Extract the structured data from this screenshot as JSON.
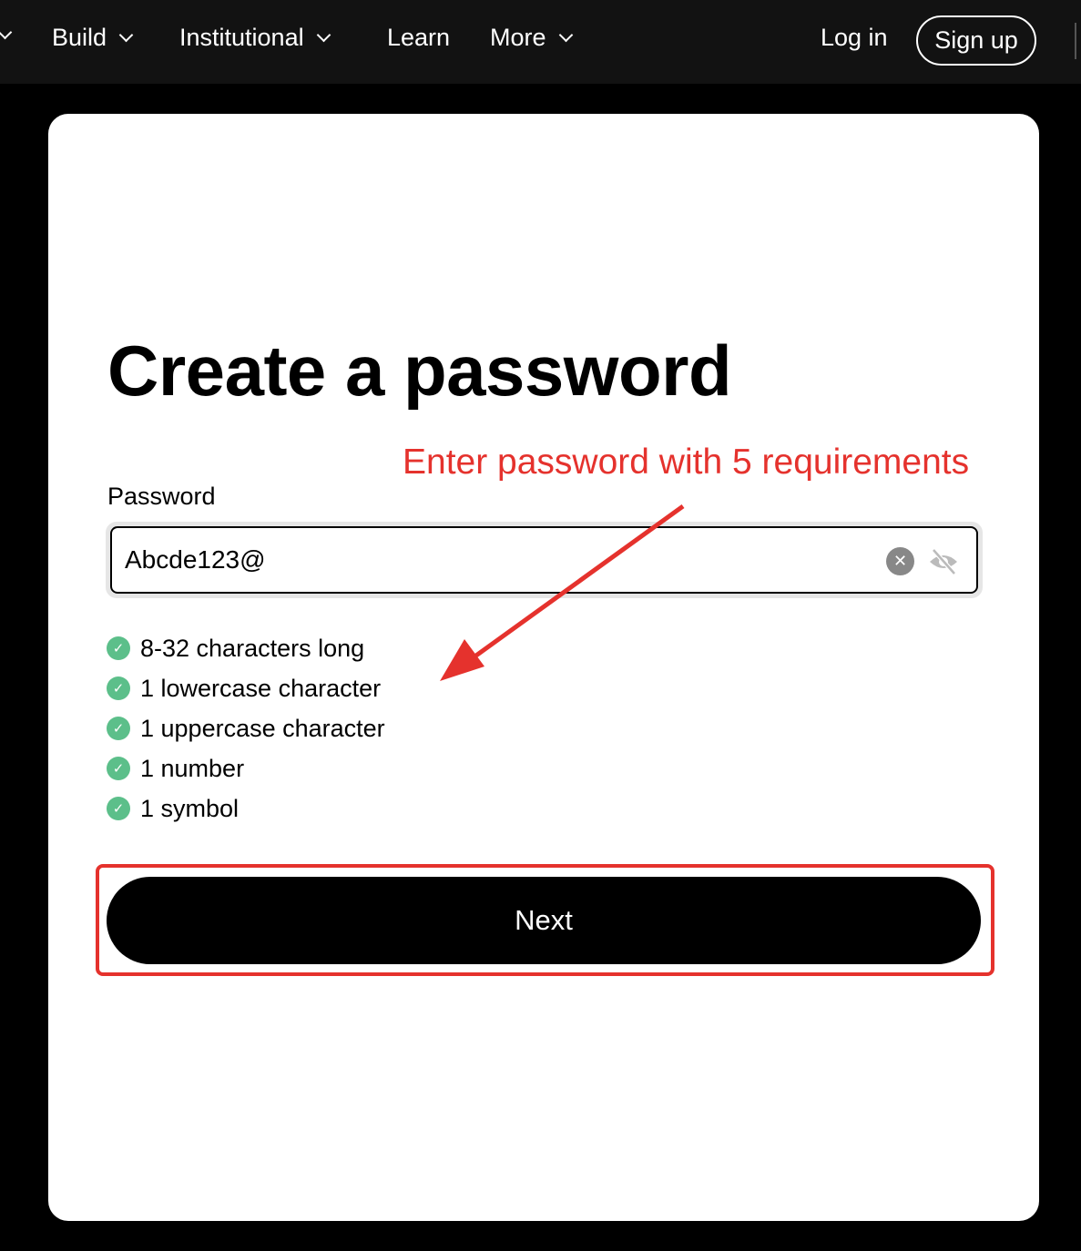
{
  "nav": {
    "items": [
      {
        "label": "Build"
      },
      {
        "label": "Institutional"
      },
      {
        "label": "Learn"
      },
      {
        "label": "More"
      }
    ],
    "login": "Log in",
    "signup": "Sign up"
  },
  "page": {
    "title": "Create a password",
    "password_label": "Password",
    "password_value": "Abcde123@",
    "requirements": [
      "8-32 characters long",
      "1 lowercase character",
      "1 uppercase character",
      "1 number",
      "1 symbol"
    ],
    "next": "Next"
  },
  "annotation": {
    "text": "Enter password with 5 requirements",
    "color": "#e5322d"
  },
  "colors": {
    "check": "#5cbf8a"
  }
}
